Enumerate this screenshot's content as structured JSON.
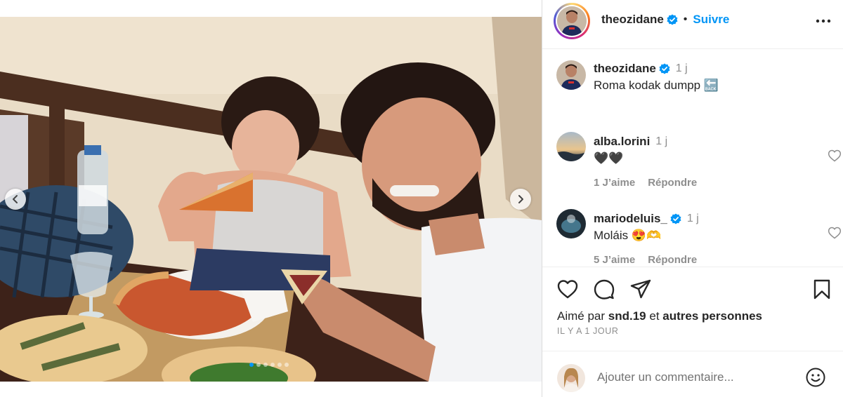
{
  "post": {
    "author": "theozidane",
    "follow_label": "Suivre",
    "separator": "•",
    "more_icon": "more-horizontal-icon"
  },
  "caption": {
    "username": "theozidane",
    "time": "1 j",
    "text": "Roma kodak dumpp 🔙"
  },
  "comments": [
    {
      "username": "alba.lorini",
      "time": "1 j",
      "text": "🖤🖤",
      "likes": "1 J’aime",
      "reply": "Répondre"
    },
    {
      "username": "mariodeluis_",
      "time": "1 j",
      "text": "Moláis 😍🫶",
      "likes": "5 J’aime",
      "reply": "Répondre"
    }
  ],
  "likes": {
    "prefix": "Aimé par",
    "user": "snd.19",
    "middle": "et",
    "suffix": "autres personnes"
  },
  "timestamp": "IL Y A 1 JOUR",
  "comment_input": {
    "placeholder": "Ajouter un commentaire..."
  },
  "carousel": {
    "slide_count": 6,
    "active_index": 0
  },
  "colors": {
    "accent": "#0095f6",
    "verified": "#0095f6",
    "text": "#262626",
    "muted": "#8e8e8e"
  }
}
